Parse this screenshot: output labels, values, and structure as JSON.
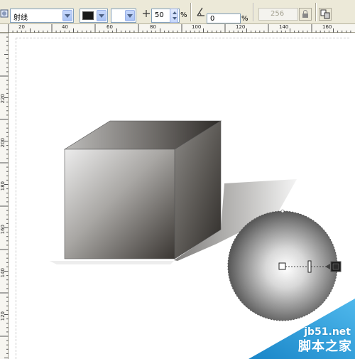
{
  "toolbar": {
    "fill_type": "射线",
    "color_swatch": "#1a1a1a",
    "midpoint_value": "50",
    "midpoint_unit": "%",
    "angle_value": "0",
    "angle_unit": "%",
    "steps_value": "256"
  },
  "ruler_top": {
    "labels": [
      "20",
      "40",
      "60",
      "80",
      "100",
      "120",
      "140",
      "160"
    ]
  },
  "ruler_left": {
    "labels": [
      "220",
      "200",
      "180",
      "160",
      "140",
      "120"
    ]
  },
  "watermark": {
    "domain": "jb51.net",
    "site_name": "脚本之家"
  },
  "colors": {
    "ui_background": "#ece9d8",
    "watermark_blue": "#2a9fd8"
  },
  "icons": {
    "fill_tool": "fountain-fill-icon",
    "midpoint": "midpoint-icon",
    "angle": "angle-icon",
    "lock": "lock-icon",
    "copy_properties": "copy-fill-icon"
  }
}
